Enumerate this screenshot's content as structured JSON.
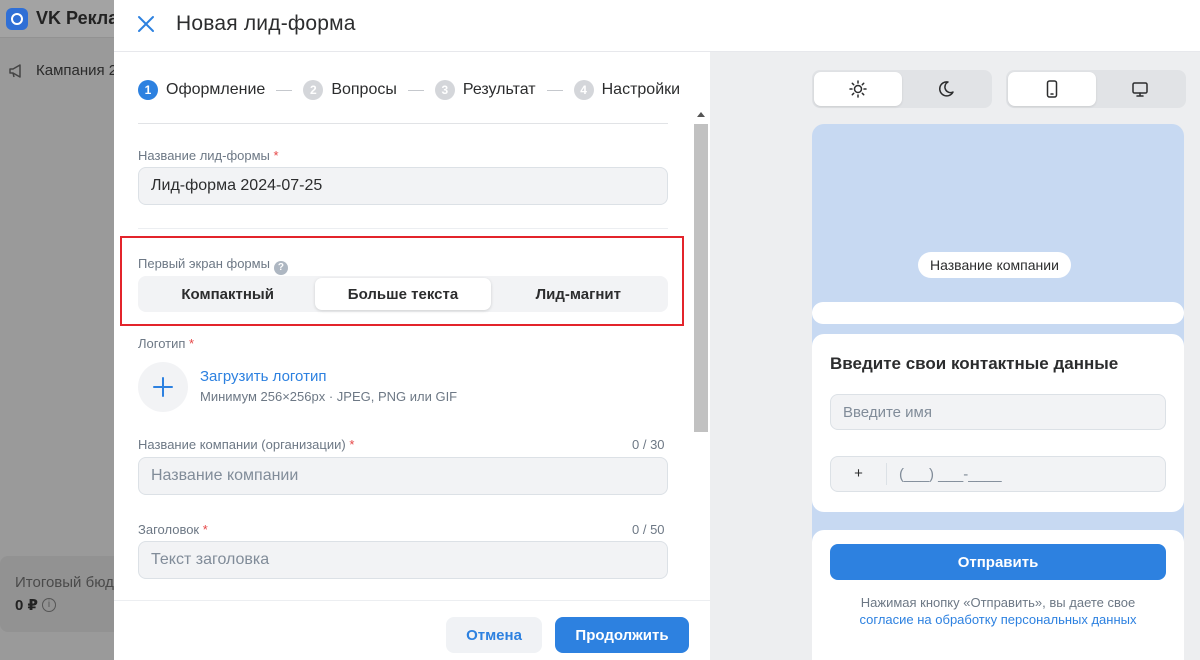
{
  "background": {
    "app_title": "VK Рекла",
    "campaign_item": "Кампания 2",
    "budget_label": "Итоговый бюд",
    "budget_value": "0 ₽",
    "info_icon": "info-icon"
  },
  "modal": {
    "title": "Новая лид-форма",
    "steps": [
      {
        "num": "1",
        "label": "Оформление"
      },
      {
        "num": "2",
        "label": "Вопросы"
      },
      {
        "num": "3",
        "label": "Результат"
      },
      {
        "num": "4",
        "label": "Настройки"
      }
    ],
    "form_name": {
      "label": "Название лид-формы",
      "required": "*",
      "value": "Лид-форма 2024-07-25"
    },
    "first_screen": {
      "label": "Первый экран формы",
      "help": "?",
      "options": [
        "Компактный",
        "Больше текста",
        "Лид-магнит"
      ],
      "selected": "Больше текста"
    },
    "logo": {
      "label": "Логотип",
      "required": "*",
      "upload_label": "Загрузить логотип",
      "hint": "Минимум 256×256px · JPEG, PNG или GIF"
    },
    "company": {
      "label": "Название компании (организации)",
      "required": "*",
      "counter": "0 / 30",
      "placeholder": "Название компании"
    },
    "heading": {
      "label": "Заголовок",
      "required": "*",
      "counter": "0 / 50",
      "placeholder": "Текст заголовка"
    },
    "footer": {
      "cancel": "Отмена",
      "continue": "Продолжить"
    }
  },
  "preview": {
    "theme_toggle": [
      "sun-icon",
      "moon-icon"
    ],
    "theme_selected": "light",
    "device_toggle": [
      "phone-icon",
      "desktop-icon"
    ],
    "device_selected": "phone",
    "company_pill": "Название компании",
    "contact_title": "Введите свои контактные данные",
    "name_placeholder": "Введите имя",
    "phone_code": "+",
    "phone_mask": "(___) ___-____",
    "submit": "Отправить",
    "consent_text": "Нажимая кнопку «Отправить», вы даете свое",
    "consent_link": "согласие на обработку персональных данных"
  },
  "colors": {
    "accent": "#2d81e0",
    "highlight_border": "#e3242b",
    "preview_bg": "#c7d9f2"
  }
}
